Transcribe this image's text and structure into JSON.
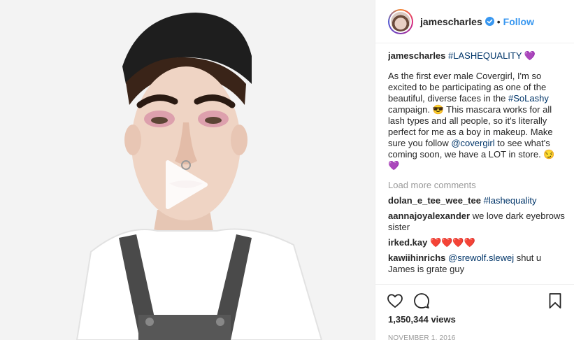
{
  "post": {
    "username": "jamescharles",
    "follow_label": "Follow",
    "separator": "•",
    "caption": {
      "username": "jamescharles",
      "hashtag": "#LASHEQUALITY",
      "hashtag_emoji": "💜",
      "text_1": "As the first ever male Covergirl, I'm so excited to be participating as one of the beautiful, diverse faces in the ",
      "hashtag_2": "#SoLashy",
      "text_2": " campaign. 😎 This mascara works for all lash types and all people, so it's literally perfect for me as a boy in makeup. Make sure you follow ",
      "mention": "@covergirl",
      "text_3": " to see what's coming soon, we have a LOT in store. 😏",
      "end_emoji": "💜"
    },
    "load_more_label": "Load more comments",
    "comments": [
      {
        "user": "dolan_e_tee_wee_tee",
        "text": "",
        "tag": "#lashequality"
      },
      {
        "user": "aannajoyalexander",
        "text": "we love dark eyebrows sister",
        "tag": ""
      },
      {
        "user": "irked.kay",
        "text": "❤️❤️❤️❤️",
        "tag": ""
      },
      {
        "user": "kawiihinrichs",
        "mention": "@srewolf.slewej",
        "text": " shut u James is grate guy"
      }
    ],
    "views": "1,350,344 views",
    "date": "NOVEMBER 1, 2016"
  },
  "colors": {
    "link": "#3897f0",
    "hashtag": "#003569",
    "muted": "#999999"
  },
  "icons": [
    "verified-badge-icon",
    "play-icon",
    "heart-icon",
    "comment-icon",
    "bookmark-icon"
  ]
}
